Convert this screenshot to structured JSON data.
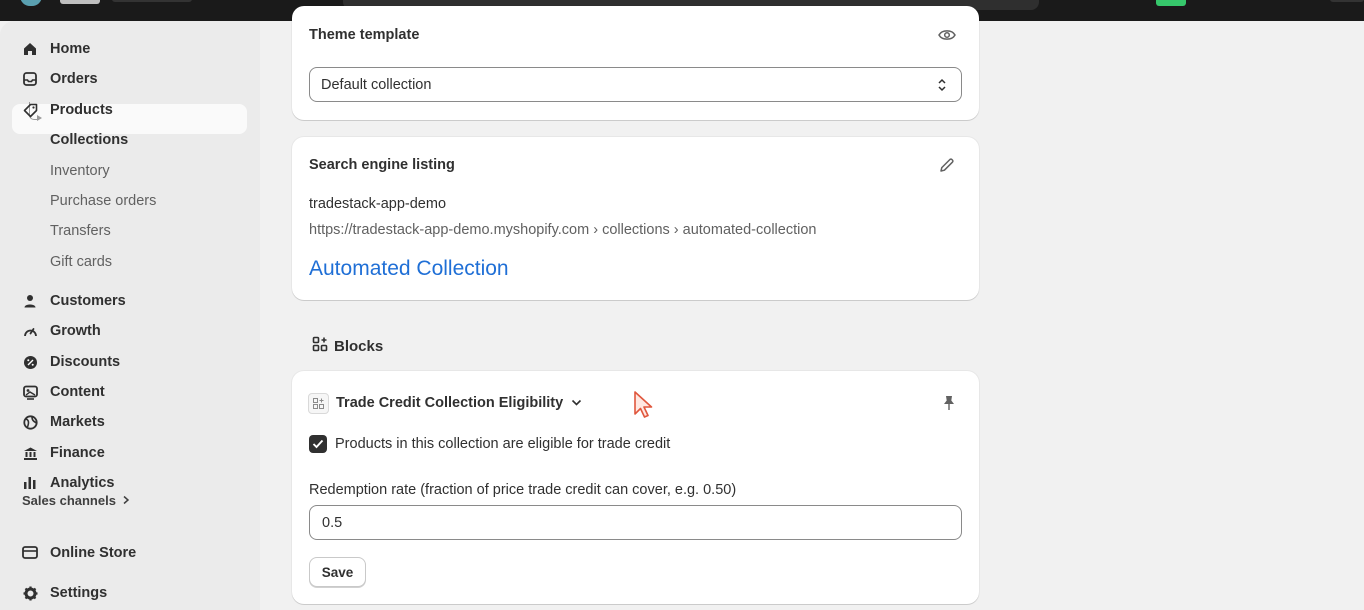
{
  "sidebar": {
    "items": [
      {
        "label": "Home",
        "icon": "home-icon"
      },
      {
        "label": "Orders",
        "icon": "inbox-icon"
      },
      {
        "label": "Products",
        "icon": "tag-icon"
      }
    ],
    "product_sub": [
      {
        "label": "Collections",
        "active": true
      },
      {
        "label": "Inventory"
      },
      {
        "label": "Purchase orders"
      },
      {
        "label": "Transfers"
      },
      {
        "label": "Gift cards"
      }
    ],
    "items2": [
      {
        "label": "Customers",
        "icon": "person-icon"
      },
      {
        "label": "Growth",
        "icon": "gauge-icon"
      },
      {
        "label": "Discounts",
        "icon": "discount-icon"
      },
      {
        "label": "Content",
        "icon": "content-icon"
      },
      {
        "label": "Markets",
        "icon": "globe-icon"
      },
      {
        "label": "Finance",
        "icon": "bank-icon"
      },
      {
        "label": "Analytics",
        "icon": "bar-chart-icon"
      }
    ],
    "sales_channels": "Sales channels",
    "online_store": "Online Store",
    "settings": "Settings"
  },
  "theme_card": {
    "title": "Theme template",
    "select_value": "Default collection"
  },
  "seo_card": {
    "title": "Search engine listing",
    "site_name": "tradestack-app-demo",
    "url": "https://tradestack-app-demo.myshopify.com › collections › automated-collection",
    "page_title": "Automated Collection"
  },
  "blocks": {
    "heading": "Blocks",
    "block": {
      "title": "Trade Credit Collection Eligibility",
      "checkbox_label": "Products in this collection are eligible for trade credit",
      "checked": true,
      "field_label": "Redemption rate (fraction of price trade credit can cover, e.g. 0.50)",
      "field_value": "0.5",
      "save_label": "Save"
    }
  },
  "colors": {
    "link": "#1f6fd6",
    "topbar": "#1a1a1a",
    "sidebar": "#ebebeb",
    "page": "#f1f1f1",
    "accent_green": "#36c76b"
  }
}
